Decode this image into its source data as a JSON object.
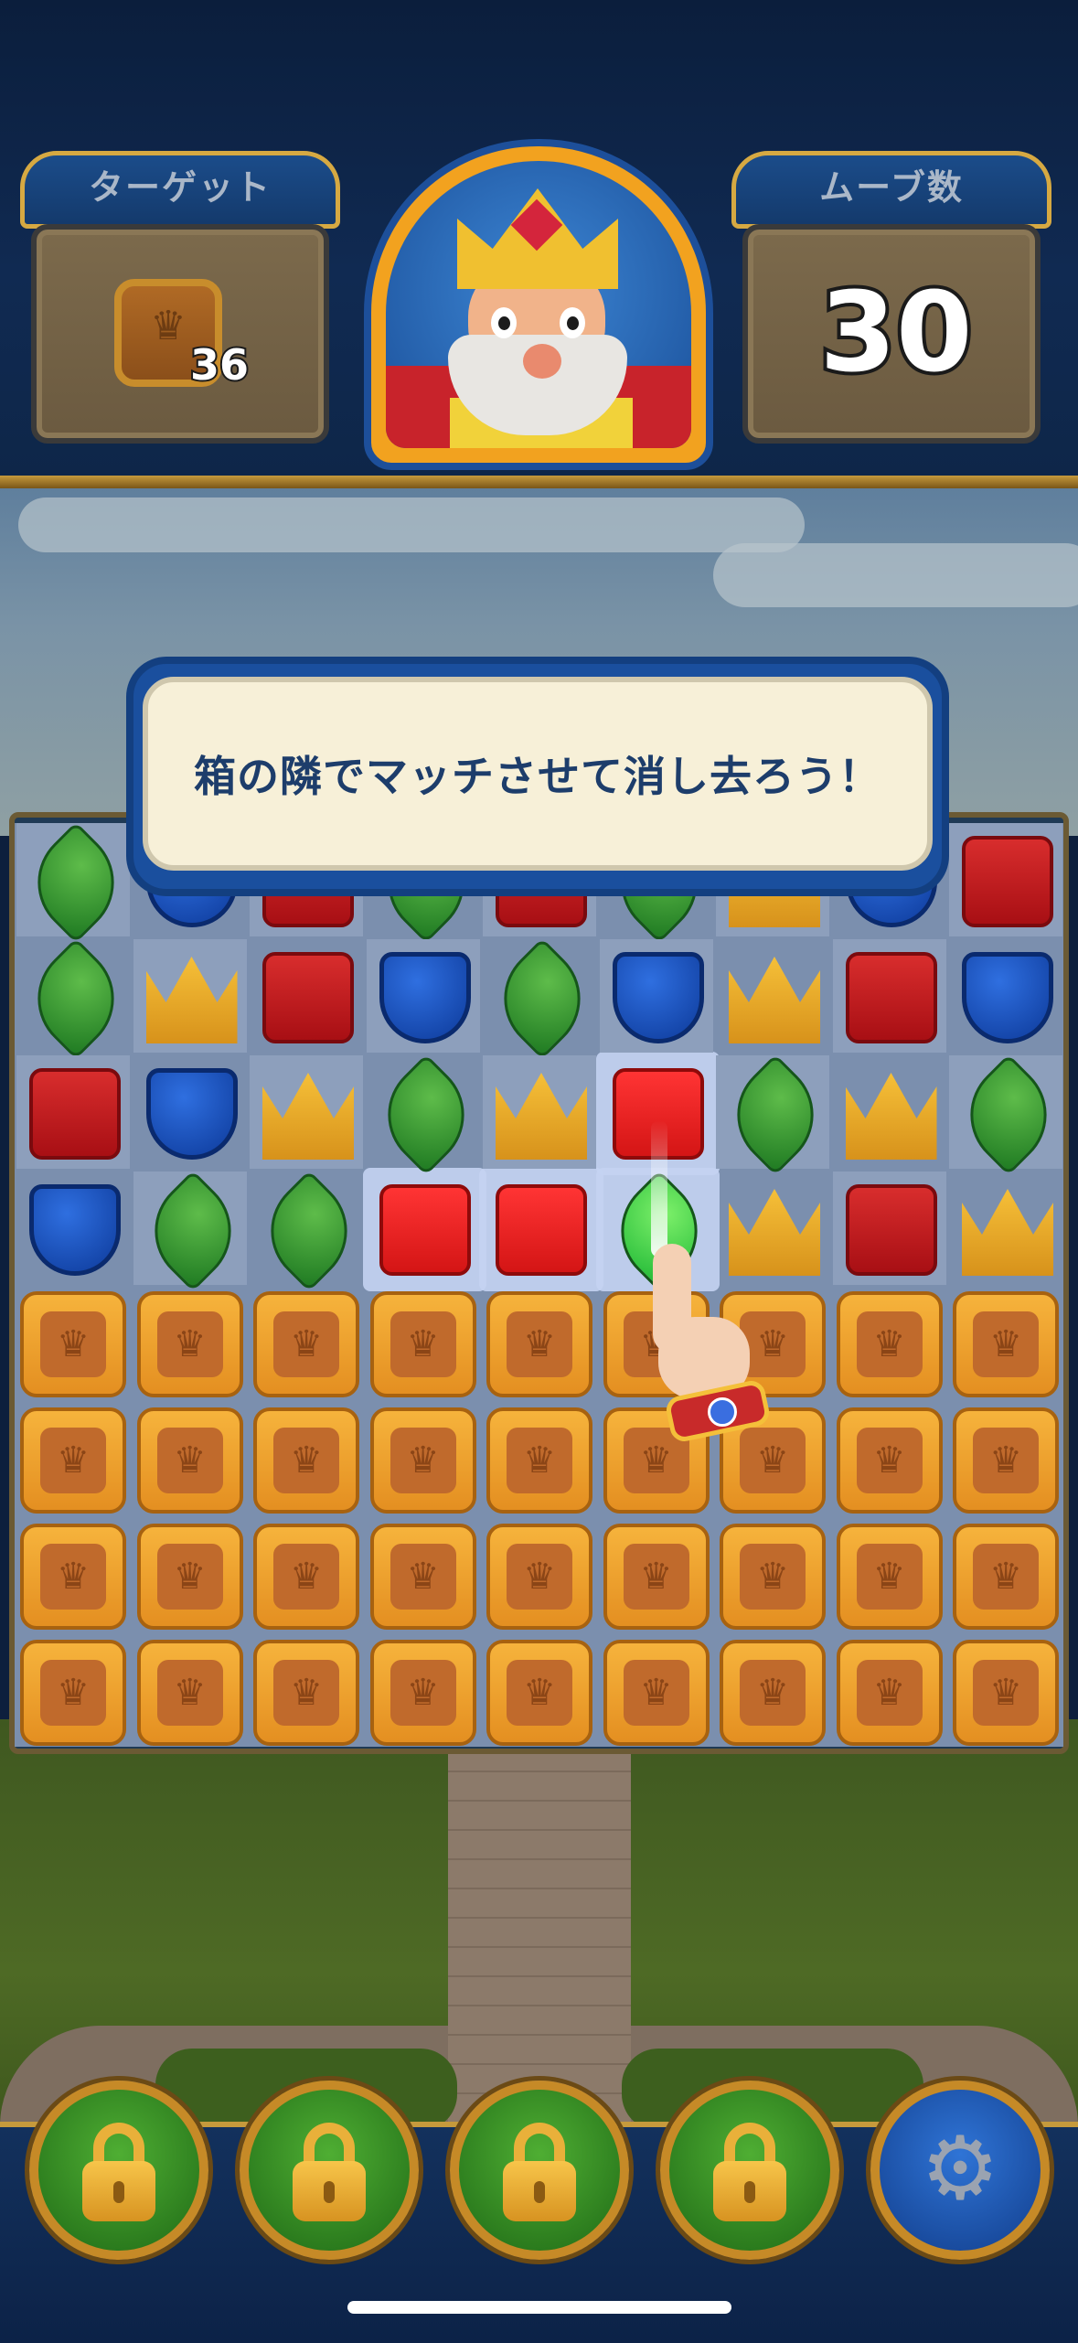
{
  "header": {
    "target_label": "ターゲット",
    "target_count": "36",
    "target_icon": "crown-crate-icon",
    "moves_label": "ムーブ数",
    "moves_value": "30",
    "avatar_icon": "king-avatar-icon"
  },
  "tutorial": {
    "message": "箱の隣でマッチさせて消し去ろう！",
    "pointer_icon": "pointing-hand-icon"
  },
  "board": {
    "columns": 9,
    "rows_visible": 8,
    "pieces": [
      [
        "leaf",
        "shield",
        "box",
        "leaf",
        "box",
        "leaf",
        "crown",
        "shield",
        "box"
      ],
      [
        "leaf",
        "crown",
        "box",
        "shield",
        "leaf",
        "shield",
        "crown",
        "box",
        "shield"
      ],
      [
        "box",
        "shield",
        "crown",
        "leaf",
        "crown",
        "box",
        "leaf",
        "crown",
        "leaf"
      ],
      [
        "shield",
        "leaf",
        "leaf",
        "box",
        "box",
        "leaf",
        "crown",
        "box",
        "crown"
      ],
      [
        "crate",
        "crate",
        "crate",
        "crate",
        "crate",
        "crate",
        "crate",
        "crate",
        "crate"
      ],
      [
        "crate",
        "crate",
        "crate",
        "crate",
        "crate",
        "crate",
        "crate",
        "crate",
        "crate"
      ],
      [
        "crate",
        "crate",
        "crate",
        "crate",
        "crate",
        "crate",
        "crate",
        "crate",
        "crate"
      ],
      [
        "crate",
        "crate",
        "crate",
        "crate",
        "crate",
        "crate",
        "crate",
        "crate",
        "crate"
      ]
    ],
    "highlighted_cells": [
      [
        2,
        5
      ],
      [
        3,
        3
      ],
      [
        3,
        4
      ],
      [
        3,
        5
      ]
    ]
  },
  "boosters": [
    {
      "name": "booster-1",
      "icon": "lock-icon",
      "locked": true
    },
    {
      "name": "booster-2",
      "icon": "lock-icon",
      "locked": true
    },
    {
      "name": "booster-3",
      "icon": "lock-icon",
      "locked": true
    },
    {
      "name": "booster-4",
      "icon": "lock-icon",
      "locked": true
    },
    {
      "name": "settings",
      "icon": "gear-icon",
      "locked": false
    }
  ],
  "colors": {
    "leaf": "#2f9a2b",
    "shield": "#1a4fc4",
    "box": "#c41e22",
    "crown": "#f0b62a",
    "crate": "#f2a531",
    "bubble_text": "#1d3d6b"
  }
}
